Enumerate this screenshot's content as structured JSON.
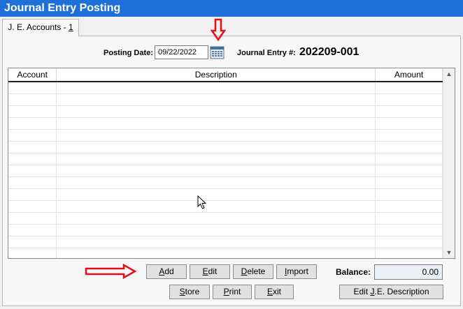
{
  "window": {
    "title": "Journal Entry Posting"
  },
  "tab": {
    "label_prefix": "J. E. Accounts - ",
    "label_hotkey": "1"
  },
  "header": {
    "posting_date_label": "Posting Date:",
    "posting_date_value": "09/22/2022",
    "journal_entry_label": "Journal Entry #:",
    "journal_entry_value": "202209-001"
  },
  "grid": {
    "columns": [
      "Account",
      "Description",
      "Amount"
    ],
    "rows": []
  },
  "buttons": {
    "add": {
      "hot": "A",
      "rest": "dd"
    },
    "edit": {
      "hot": "E",
      "rest": "dit"
    },
    "delete": {
      "hot": "D",
      "rest": "elete"
    },
    "import": {
      "hot": "I",
      "rest": "mport"
    },
    "store": {
      "hot": "S",
      "rest": "tore"
    },
    "print": {
      "hot": "P",
      "rest": "rint"
    },
    "exit": {
      "hot": "E",
      "rest": "xit"
    },
    "edit_description": {
      "pre": "Edit ",
      "hot": "J",
      "rest": ".E. Description"
    }
  },
  "balance": {
    "label": "Balance:",
    "value": "0.00"
  },
  "colors": {
    "titlebar": "#1e6fd8",
    "annotation_arrow": "#e0101a"
  },
  "icons": {
    "calendar": "calendar-icon",
    "annotation": "red-arrow-icon",
    "cursor": "mouse-pointer-icon"
  }
}
